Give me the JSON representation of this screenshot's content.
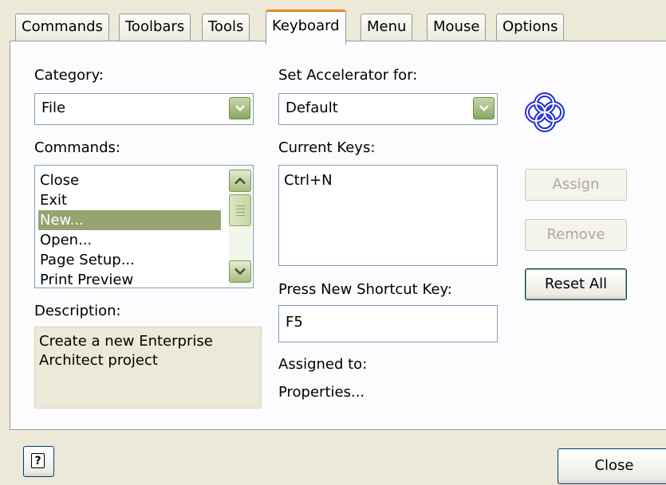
{
  "tabs": [
    {
      "label": "Commands"
    },
    {
      "label": "Toolbars"
    },
    {
      "label": "Tools"
    },
    {
      "label": "Keyboard",
      "active": true
    },
    {
      "label": "Menu"
    },
    {
      "label": "Mouse"
    },
    {
      "label": "Options"
    }
  ],
  "category": {
    "label": "Category:",
    "value": "File"
  },
  "accelerator": {
    "label": "Set Accelerator for:",
    "value": "Default"
  },
  "commands": {
    "label": "Commands:",
    "items": [
      "Close",
      "Exit",
      "New...",
      "Open...",
      "Page Setup...",
      "Print Preview"
    ],
    "selected_index": 2
  },
  "current_keys": {
    "label": "Current Keys:",
    "items": [
      "Ctrl+N"
    ]
  },
  "description": {
    "label": "Description:",
    "text_line1": "Create a new Enterprise",
    "text_line2": "Architect project"
  },
  "shortcut": {
    "label": "Press New Shortcut Key:",
    "value": "F5"
  },
  "assigned": {
    "label": "Assigned to:",
    "value": "Properties..."
  },
  "buttons": {
    "assign": "Assign",
    "remove": "Remove",
    "reset_all": "Reset All",
    "close": "Close"
  },
  "icons": {
    "logo": "enterprise-architect-logo-icon",
    "help": "help-icon"
  },
  "colors": {
    "accent_tab": "#e68b2c",
    "selection": "#97a371",
    "logo": "#1f2fd6"
  }
}
